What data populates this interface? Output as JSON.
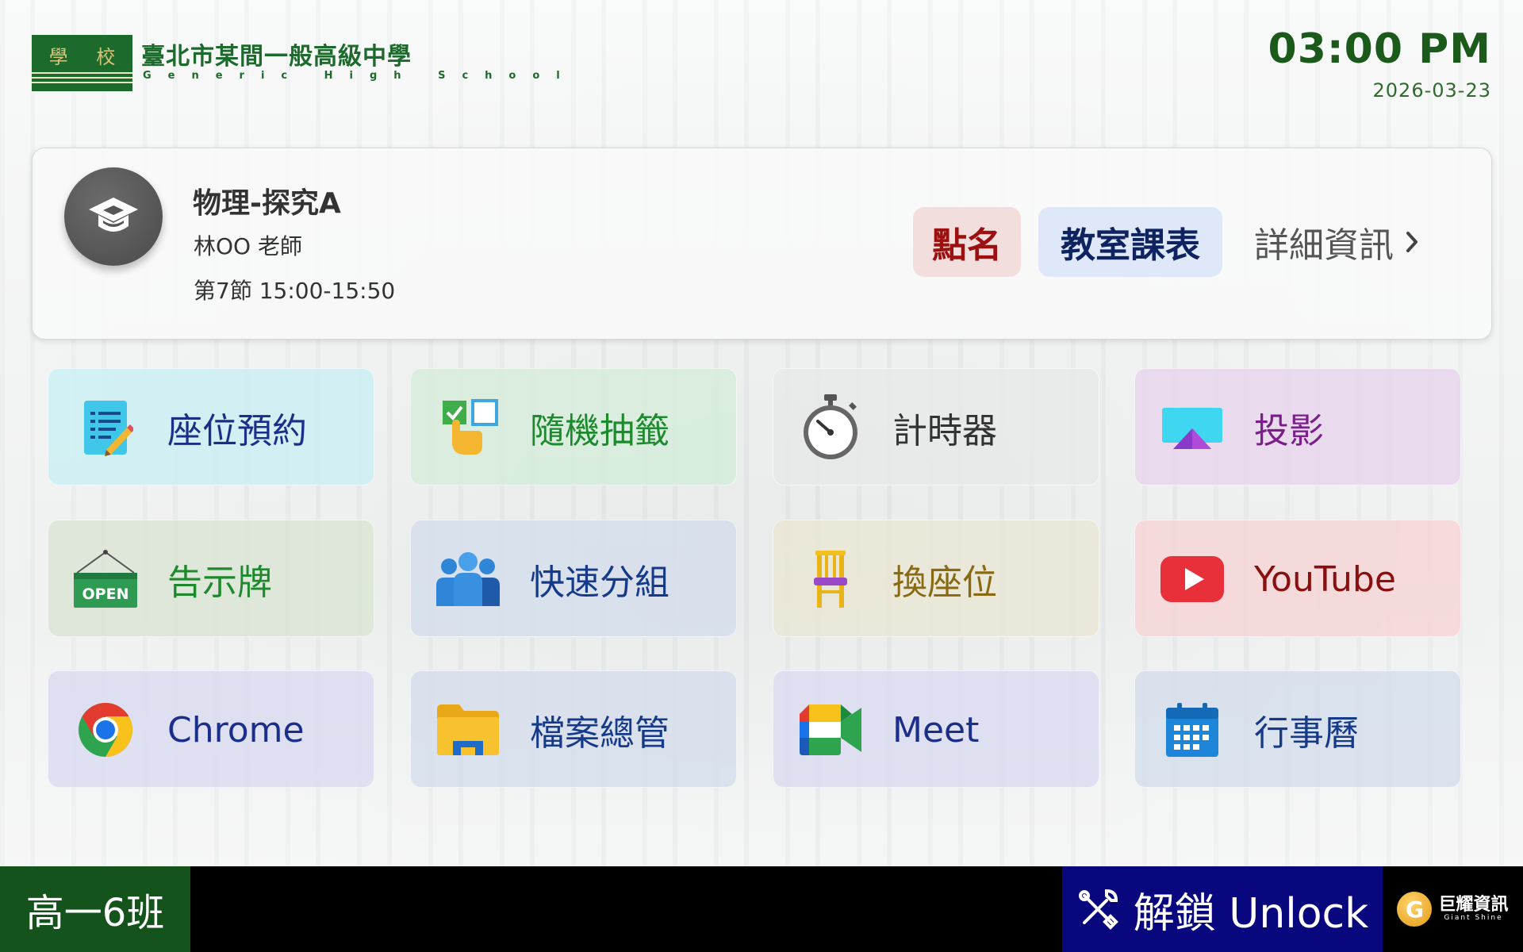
{
  "header": {
    "logo_text": "學 校",
    "school_name": "臺北市某間一般高級中學",
    "school_name_en": "Generic High School",
    "time": "03:00 PM",
    "date": "2026-03-23"
  },
  "class_card": {
    "subject": "物理-探究A",
    "teacher": "林OO 老師",
    "period": "第7節 15:00-15:50",
    "rollcall_label": "點名",
    "schedule_label": "教室課表",
    "detail_label": "詳細資訊"
  },
  "tiles": [
    {
      "label": "座位預約",
      "icon": "seat-reservation-icon",
      "color": "#1a2f8a",
      "bg": "rgba(205,240,243,0.85)"
    },
    {
      "label": "隨機抽籤",
      "icon": "random-draw-icon",
      "color": "#1e8a2e",
      "bg": "rgba(214,236,219,0.85)"
    },
    {
      "label": "計時器",
      "icon": "stopwatch-icon",
      "color": "#333333",
      "bg": "rgba(232,233,233,0.85)"
    },
    {
      "label": "投影",
      "icon": "projection-icon",
      "color": "#7a1f8a",
      "bg": "rgba(232,214,236,0.85)"
    },
    {
      "label": "告示牌",
      "icon": "open-sign-icon",
      "color": "#1e8a2e",
      "bg": "rgba(219,229,214,0.85)"
    },
    {
      "label": "快速分組",
      "icon": "group-icon",
      "color": "#153a8a",
      "bg": "rgba(214,222,236,0.85)"
    },
    {
      "label": "換座位",
      "icon": "chair-icon",
      "color": "#8a6a10",
      "bg": "rgba(234,230,214,0.85)"
    },
    {
      "label": "YouTube",
      "icon": "youtube-icon",
      "color": "#8a1010",
      "bg": "rgba(246,214,216,0.88)"
    },
    {
      "label": "Chrome",
      "icon": "chrome-icon",
      "color": "#1a2f8a",
      "bg": "rgba(218,220,240,0.85)"
    },
    {
      "label": "檔案總管",
      "icon": "folder-icon",
      "color": "#153a8a",
      "bg": "rgba(214,222,236,0.85)"
    },
    {
      "label": "Meet",
      "icon": "meet-icon",
      "color": "#1a2f8a",
      "bg": "rgba(218,220,240,0.85)"
    },
    {
      "label": "行事曆",
      "icon": "calendar-icon",
      "color": "#153a8a",
      "bg": "rgba(214,222,236,0.85)"
    }
  ],
  "footer": {
    "class_name": "高一6班",
    "unlock_label": "解鎖 Unlock",
    "brand_cn": "巨耀資訊",
    "brand_en": "Giant Shine",
    "brand_letter": "G"
  },
  "colors": {
    "school_green": "#1c6a2c",
    "unlock_blue": "#08077e"
  }
}
